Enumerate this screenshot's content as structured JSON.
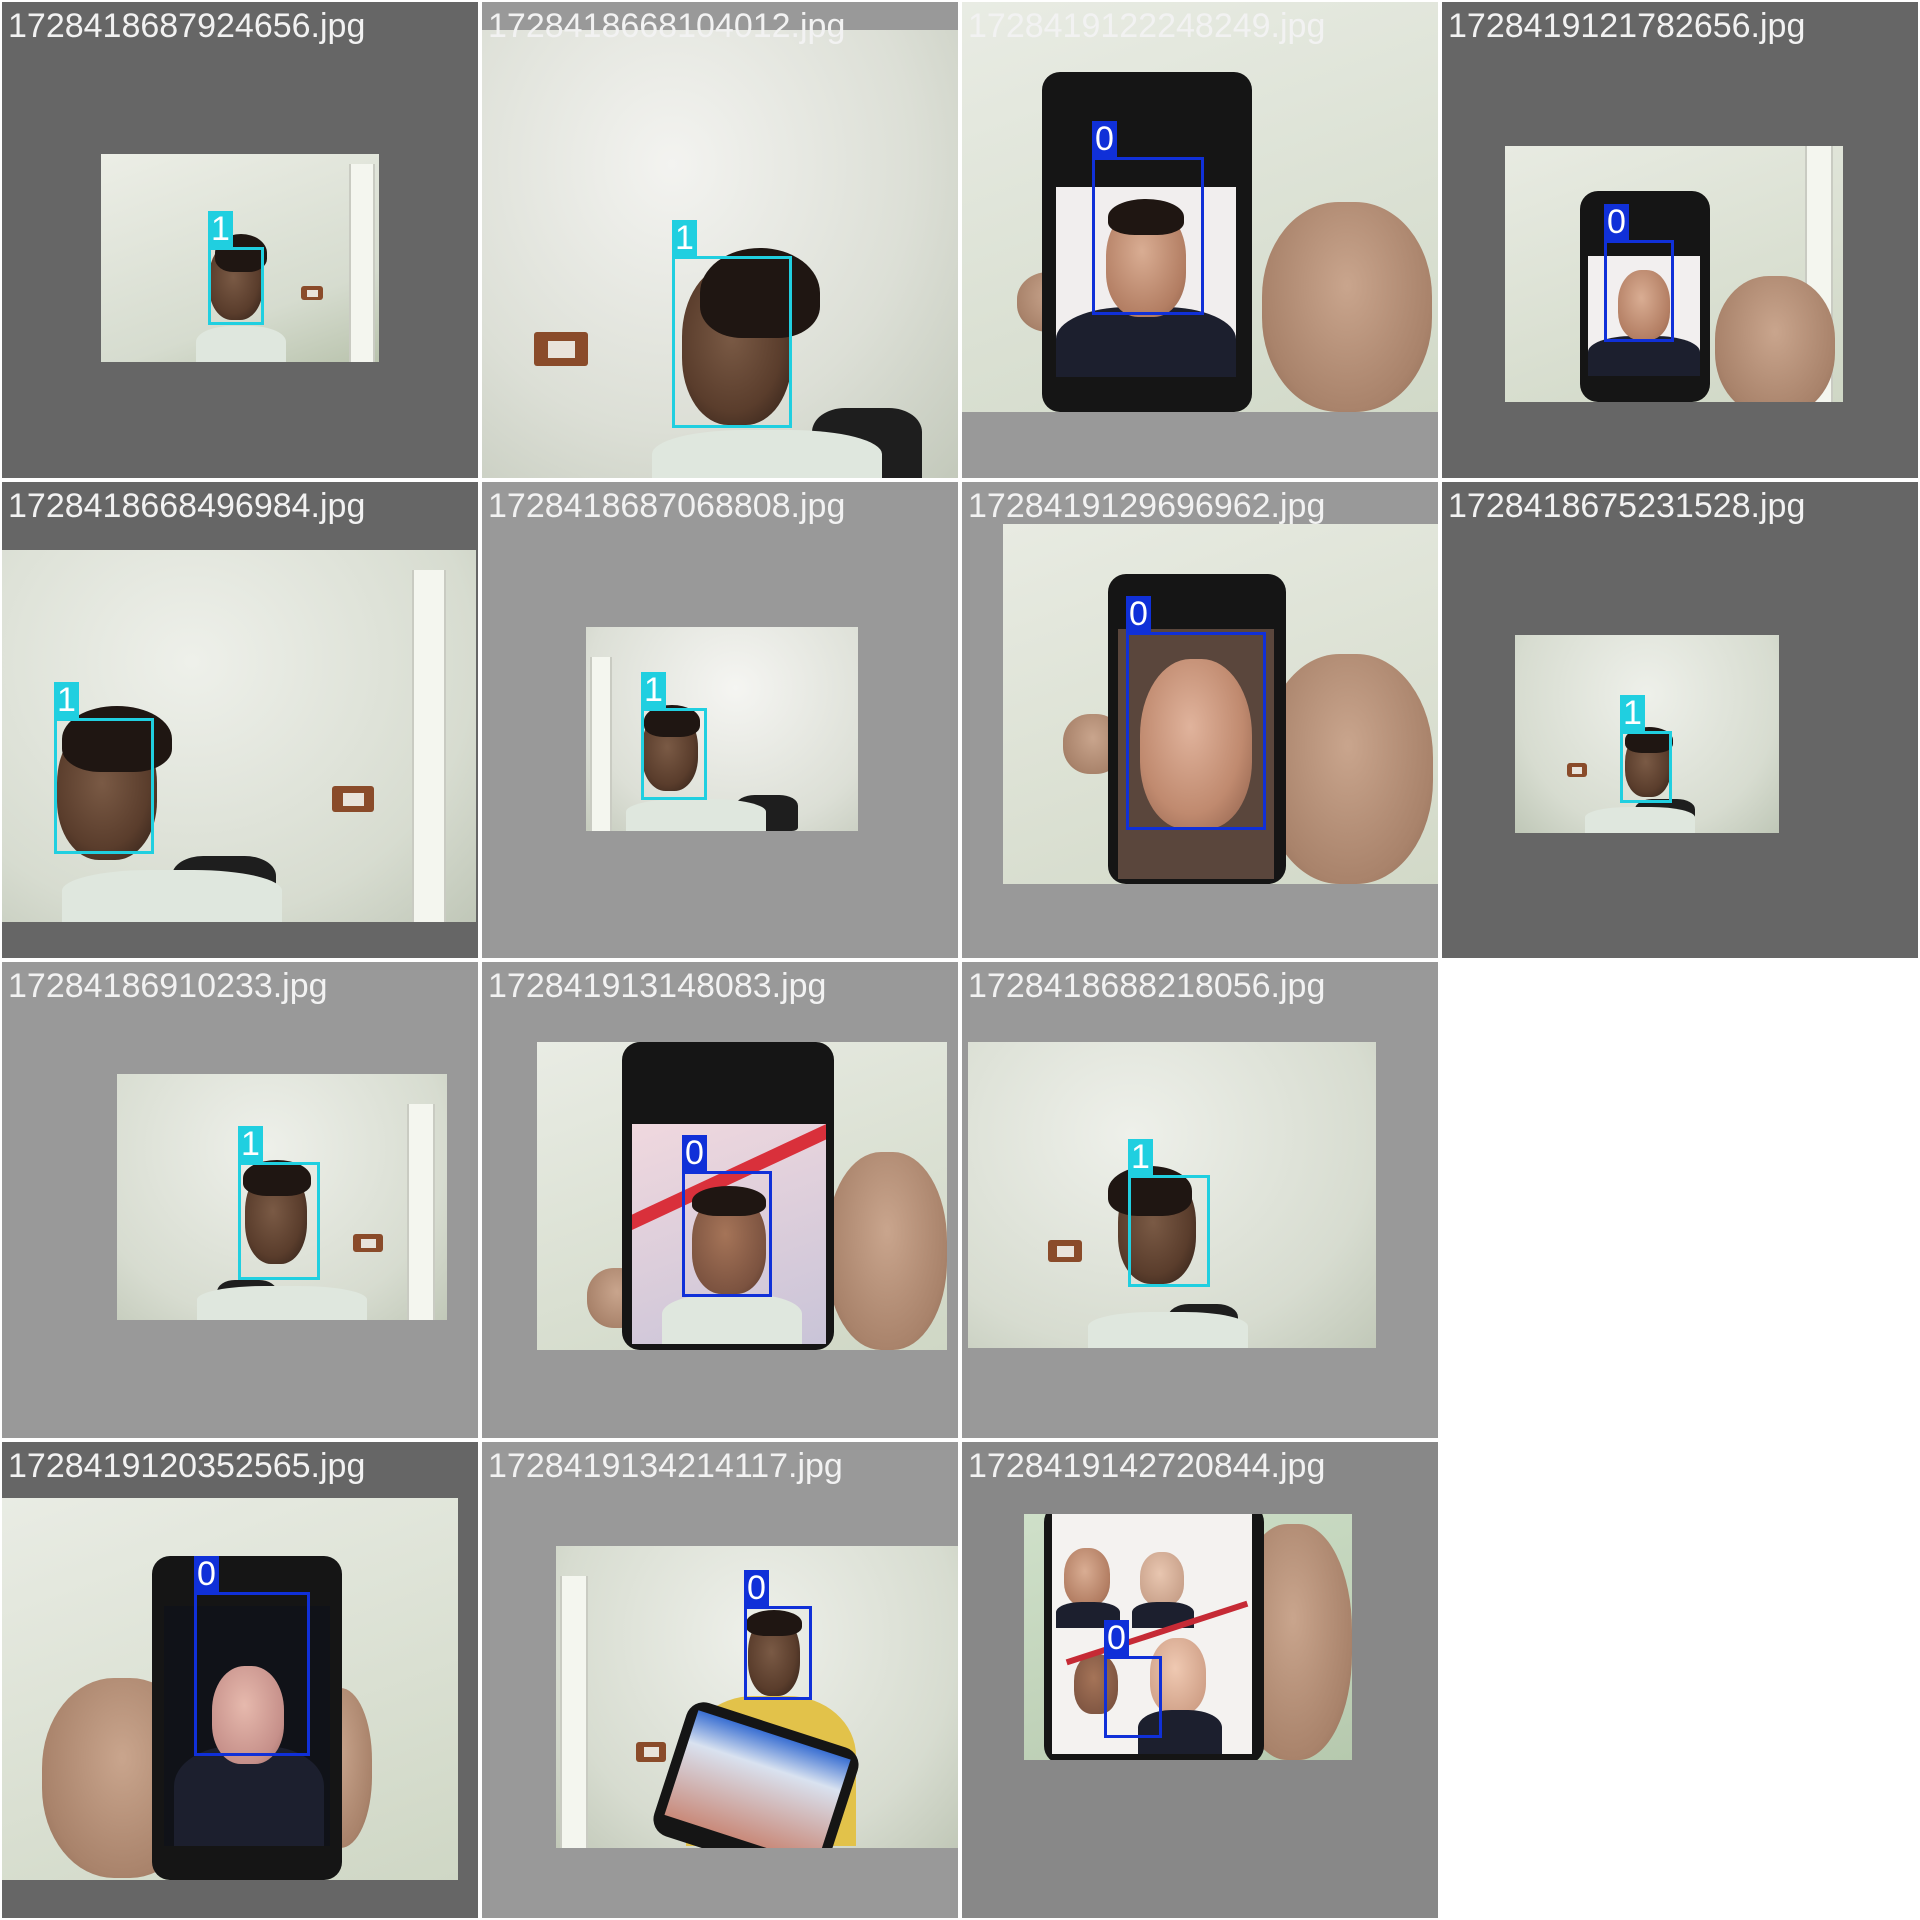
{
  "title": "",
  "colors": {
    "class_0": "#1030d8",
    "class_1": "#20cfe0",
    "tile_bg_dark": "#666666",
    "tile_bg_mid": "#888888",
    "tile_bg_light": "#999999"
  },
  "tiles": [
    {
      "filename": "1728418687924656.jpg",
      "detections": [
        {
          "label": "1",
          "class": 1
        }
      ]
    },
    {
      "filename": "1728418668104012.jpg",
      "detections": [
        {
          "label": "1",
          "class": 1
        }
      ]
    },
    {
      "filename": "1728419122248249.jpg",
      "detections": [
        {
          "label": "0",
          "class": 0
        }
      ]
    },
    {
      "filename": "1728419121782656.jpg",
      "detections": [
        {
          "label": "0",
          "class": 0
        }
      ]
    },
    {
      "filename": "1728418668496984.jpg",
      "detections": [
        {
          "label": "1",
          "class": 1
        }
      ]
    },
    {
      "filename": "1728418687068808.jpg",
      "detections": [
        {
          "label": "1",
          "class": 1
        }
      ]
    },
    {
      "filename": "1728419129696962.jpg",
      "detections": [
        {
          "label": "0",
          "class": 0
        }
      ]
    },
    {
      "filename": "1728418675231528.jpg",
      "detections": [
        {
          "label": "1",
          "class": 1
        }
      ]
    },
    {
      "filename": "17284186910233.jpg",
      "detections": [
        {
          "label": "1",
          "class": 1
        }
      ]
    },
    {
      "filename": "172841913148083.jpg",
      "detections": [
        {
          "label": "0",
          "class": 0
        }
      ]
    },
    {
      "filename": "1728418688218056.jpg",
      "detections": [
        {
          "label": "1",
          "class": 1
        }
      ]
    },
    {
      "filename": "1728419120352565.jpg",
      "detections": [
        {
          "label": "0",
          "class": 0
        }
      ]
    },
    {
      "filename": "1728419134214117.jpg",
      "detections": [
        {
          "label": "0",
          "class": 0
        }
      ]
    },
    {
      "filename": "1728419142720844.jpg",
      "detections": [
        {
          "label": "0",
          "class": 0
        }
      ]
    }
  ]
}
